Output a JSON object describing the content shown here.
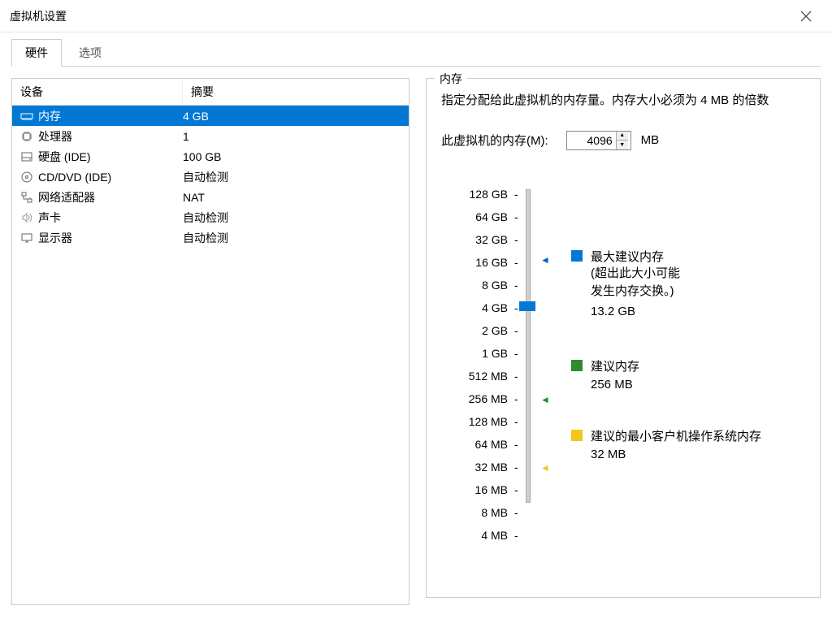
{
  "window": {
    "title": "虚拟机设置"
  },
  "tabs": {
    "hardware": "硬件",
    "options": "选项"
  },
  "table": {
    "headers": {
      "device": "设备",
      "summary": "摘要"
    },
    "rows": [
      {
        "device": "内存",
        "summary": "4 GB",
        "selected": true
      },
      {
        "device": "处理器",
        "summary": "1"
      },
      {
        "device": "硬盘 (IDE)",
        "summary": "100 GB"
      },
      {
        "device": "CD/DVD (IDE)",
        "summary": "自动检测"
      },
      {
        "device": "网络适配器",
        "summary": "NAT"
      },
      {
        "device": "声卡",
        "summary": "自动检测"
      },
      {
        "device": "显示器",
        "summary": "自动检测"
      }
    ]
  },
  "memory": {
    "panel_title": "内存",
    "description": "指定分配给此虚拟机的内存量。内存大小必须为 4 MB 的倍数",
    "input_label": "此虚拟机的内存(M):",
    "input_value": "4096",
    "unit": "MB",
    "slider_labels": [
      "128 GB",
      "64 GB",
      "32 GB",
      "16 GB",
      "8 GB",
      "4 GB",
      "2 GB",
      "1 GB",
      "512 MB",
      "256 MB",
      "128 MB",
      "64 MB",
      "32 MB",
      "16 MB",
      "8 MB",
      "4 MB"
    ],
    "legend": {
      "max": {
        "title": "最大建议内存",
        "sub1": "(超出此大小可能",
        "sub2": "发生内存交换。)",
        "value": "13.2 GB"
      },
      "rec": {
        "title": "建议内存",
        "value": "256 MB"
      },
      "min": {
        "title": "建议的最小客户机操作系统内存",
        "value": "32 MB"
      }
    }
  }
}
